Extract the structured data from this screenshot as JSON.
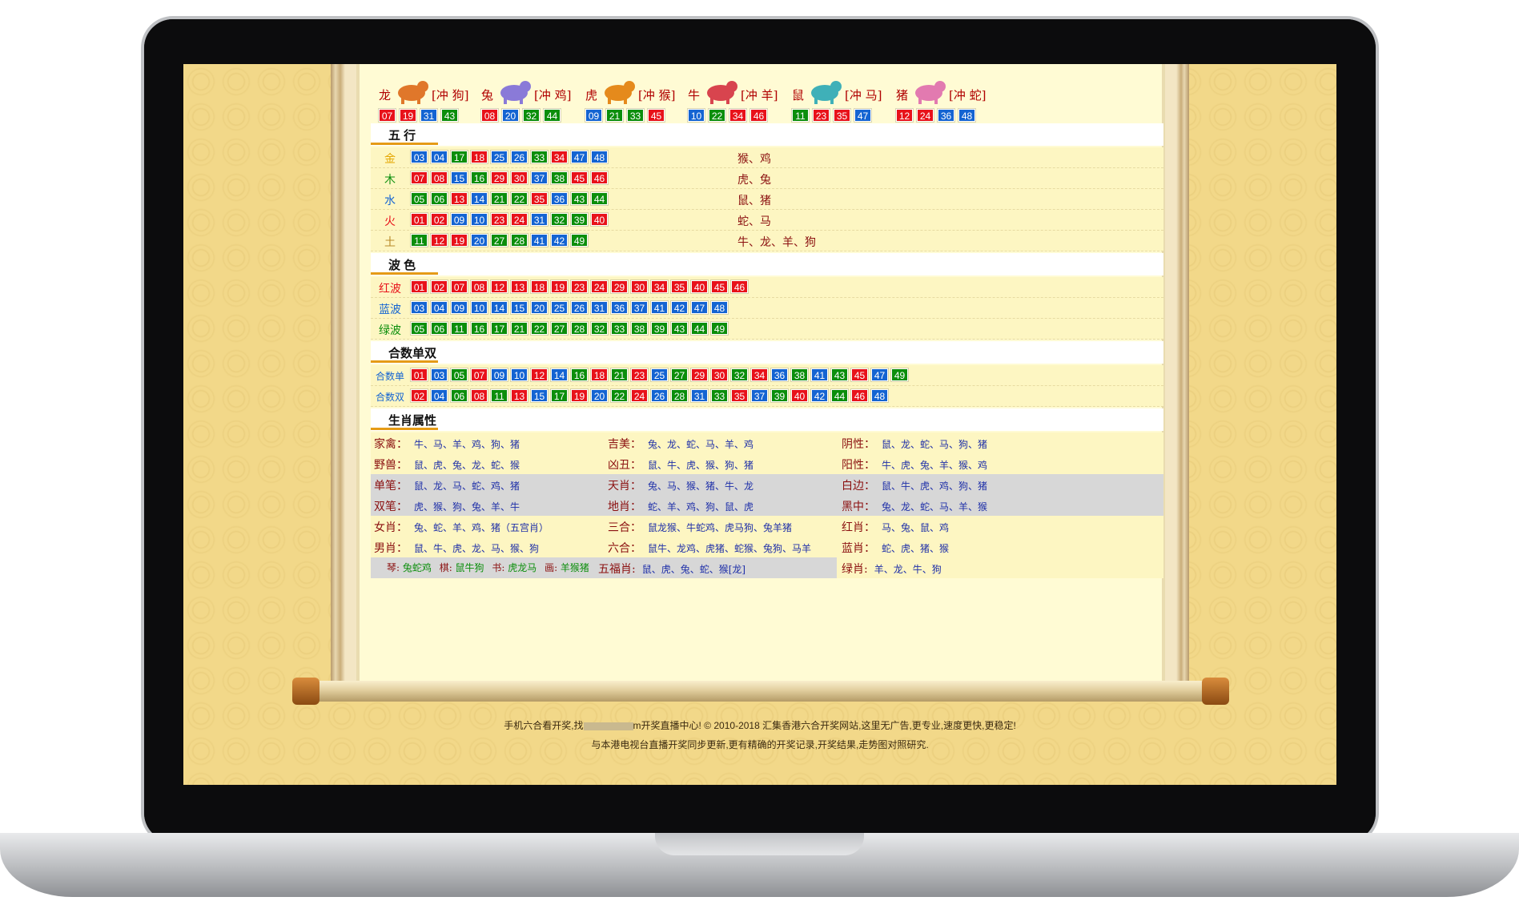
{
  "zodiac_row": [
    {
      "name": "龙",
      "clash": "[冲 狗]",
      "balls": [
        {
          "n": "07",
          "c": "r"
        },
        {
          "n": "19",
          "c": "r"
        },
        {
          "n": "31",
          "c": "b"
        },
        {
          "n": "43",
          "c": "g"
        }
      ]
    },
    {
      "name": "兔",
      "clash": "[冲 鸡]",
      "balls": [
        {
          "n": "08",
          "c": "r"
        },
        {
          "n": "20",
          "c": "b"
        },
        {
          "n": "32",
          "c": "g"
        },
        {
          "n": "44",
          "c": "g"
        }
      ]
    },
    {
      "name": "虎",
      "clash": "[冲 猴]",
      "balls": [
        {
          "n": "09",
          "c": "b"
        },
        {
          "n": "21",
          "c": "g"
        },
        {
          "n": "33",
          "c": "g"
        },
        {
          "n": "45",
          "c": "r"
        }
      ]
    },
    {
      "name": "牛",
      "clash": "[冲 羊]",
      "balls": [
        {
          "n": "10",
          "c": "b"
        },
        {
          "n": "22",
          "c": "g"
        },
        {
          "n": "34",
          "c": "r"
        },
        {
          "n": "46",
          "c": "r"
        }
      ]
    },
    {
      "name": "鼠",
      "clash": "[冲 马]",
      "balls": [
        {
          "n": "11",
          "c": "g"
        },
        {
          "n": "23",
          "c": "r"
        },
        {
          "n": "35",
          "c": "r"
        },
        {
          "n": "47",
          "c": "b"
        }
      ]
    },
    {
      "name": "猪",
      "clash": "[冲 蛇]",
      "balls": [
        {
          "n": "12",
          "c": "r"
        },
        {
          "n": "24",
          "c": "r"
        },
        {
          "n": "36",
          "c": "b"
        },
        {
          "n": "48",
          "c": "b"
        }
      ]
    }
  ],
  "sections": {
    "wuxing": "五 行",
    "bose": "波 色",
    "heshu": "合数单双",
    "shengxiao": "生肖属性"
  },
  "wuxing_rows": [
    {
      "label": "金",
      "color": "#e4a600",
      "balls": [
        {
          "n": "03",
          "c": "b"
        },
        {
          "n": "04",
          "c": "b"
        },
        {
          "n": "17",
          "c": "g"
        },
        {
          "n": "18",
          "c": "r"
        },
        {
          "n": "25",
          "c": "b"
        },
        {
          "n": "26",
          "c": "b"
        },
        {
          "n": "33",
          "c": "g"
        },
        {
          "n": "34",
          "c": "r"
        },
        {
          "n": "47",
          "c": "b"
        },
        {
          "n": "48",
          "c": "b"
        }
      ],
      "assoc": "猴、鸡"
    },
    {
      "label": "木",
      "color": "#0b8e0b",
      "balls": [
        {
          "n": "07",
          "c": "r"
        },
        {
          "n": "08",
          "c": "r"
        },
        {
          "n": "15",
          "c": "b"
        },
        {
          "n": "16",
          "c": "g"
        },
        {
          "n": "29",
          "c": "r"
        },
        {
          "n": "30",
          "c": "r"
        },
        {
          "n": "37",
          "c": "b"
        },
        {
          "n": "38",
          "c": "g"
        },
        {
          "n": "45",
          "c": "r"
        },
        {
          "n": "46",
          "c": "r"
        }
      ],
      "assoc": "虎、兔"
    },
    {
      "label": "水",
      "color": "#1464d2",
      "balls": [
        {
          "n": "05",
          "c": "g"
        },
        {
          "n": "06",
          "c": "g"
        },
        {
          "n": "13",
          "c": "r"
        },
        {
          "n": "14",
          "c": "b"
        },
        {
          "n": "21",
          "c": "g"
        },
        {
          "n": "22",
          "c": "g"
        },
        {
          "n": "35",
          "c": "r"
        },
        {
          "n": "36",
          "c": "b"
        },
        {
          "n": "43",
          "c": "g"
        },
        {
          "n": "44",
          "c": "g"
        }
      ],
      "assoc": "鼠、猪"
    },
    {
      "label": "火",
      "color": "#e8121a",
      "balls": [
        {
          "n": "01",
          "c": "r"
        },
        {
          "n": "02",
          "c": "r"
        },
        {
          "n": "09",
          "c": "b"
        },
        {
          "n": "10",
          "c": "b"
        },
        {
          "n": "23",
          "c": "r"
        },
        {
          "n": "24",
          "c": "r"
        },
        {
          "n": "31",
          "c": "b"
        },
        {
          "n": "32",
          "c": "g"
        },
        {
          "n": "39",
          "c": "g"
        },
        {
          "n": "40",
          "c": "r"
        }
      ],
      "assoc": "蛇、马"
    },
    {
      "label": "土",
      "color": "#b98a2a",
      "balls": [
        {
          "n": "11",
          "c": "g"
        },
        {
          "n": "12",
          "c": "r"
        },
        {
          "n": "19",
          "c": "r"
        },
        {
          "n": "20",
          "c": "b"
        },
        {
          "n": "27",
          "c": "g"
        },
        {
          "n": "28",
          "c": "g"
        },
        {
          "n": "41",
          "c": "b"
        },
        {
          "n": "42",
          "c": "b"
        },
        {
          "n": "49",
          "c": "g"
        }
      ],
      "assoc": "牛、龙、羊、狗"
    }
  ],
  "bose_rows": [
    {
      "label": "红波",
      "color": "#e8121a",
      "balls": [
        {
          "n": "01",
          "c": "r"
        },
        {
          "n": "02",
          "c": "r"
        },
        {
          "n": "07",
          "c": "r"
        },
        {
          "n": "08",
          "c": "r"
        },
        {
          "n": "12",
          "c": "r"
        },
        {
          "n": "13",
          "c": "r"
        },
        {
          "n": "18",
          "c": "r"
        },
        {
          "n": "19",
          "c": "r"
        },
        {
          "n": "23",
          "c": "r"
        },
        {
          "n": "24",
          "c": "r"
        },
        {
          "n": "29",
          "c": "r"
        },
        {
          "n": "30",
          "c": "r"
        },
        {
          "n": "34",
          "c": "r"
        },
        {
          "n": "35",
          "c": "r"
        },
        {
          "n": "40",
          "c": "r"
        },
        {
          "n": "45",
          "c": "r"
        },
        {
          "n": "46",
          "c": "r"
        }
      ]
    },
    {
      "label": "蓝波",
      "color": "#1464d2",
      "balls": [
        {
          "n": "03",
          "c": "b"
        },
        {
          "n": "04",
          "c": "b"
        },
        {
          "n": "09",
          "c": "b"
        },
        {
          "n": "10",
          "c": "b"
        },
        {
          "n": "14",
          "c": "b"
        },
        {
          "n": "15",
          "c": "b"
        },
        {
          "n": "20",
          "c": "b"
        },
        {
          "n": "25",
          "c": "b"
        },
        {
          "n": "26",
          "c": "b"
        },
        {
          "n": "31",
          "c": "b"
        },
        {
          "n": "36",
          "c": "b"
        },
        {
          "n": "37",
          "c": "b"
        },
        {
          "n": "41",
          "c": "b"
        },
        {
          "n": "42",
          "c": "b"
        },
        {
          "n": "47",
          "c": "b"
        },
        {
          "n": "48",
          "c": "b"
        }
      ]
    },
    {
      "label": "绿波",
      "color": "#0b8e0b",
      "balls": [
        {
          "n": "05",
          "c": "g"
        },
        {
          "n": "06",
          "c": "g"
        },
        {
          "n": "11",
          "c": "g"
        },
        {
          "n": "16",
          "c": "g"
        },
        {
          "n": "17",
          "c": "g"
        },
        {
          "n": "21",
          "c": "g"
        },
        {
          "n": "22",
          "c": "g"
        },
        {
          "n": "27",
          "c": "g"
        },
        {
          "n": "28",
          "c": "g"
        },
        {
          "n": "32",
          "c": "g"
        },
        {
          "n": "33",
          "c": "g"
        },
        {
          "n": "38",
          "c": "g"
        },
        {
          "n": "39",
          "c": "g"
        },
        {
          "n": "43",
          "c": "g"
        },
        {
          "n": "44",
          "c": "g"
        },
        {
          "n": "49",
          "c": "g"
        }
      ]
    }
  ],
  "heshu_rows": [
    {
      "label": "合数单",
      "color": "#1464d2",
      "balls": [
        {
          "n": "01",
          "c": "r"
        },
        {
          "n": "03",
          "c": "b"
        },
        {
          "n": "05",
          "c": "g"
        },
        {
          "n": "07",
          "c": "r"
        },
        {
          "n": "09",
          "c": "b"
        },
        {
          "n": "10",
          "c": "b"
        },
        {
          "n": "12",
          "c": "r"
        },
        {
          "n": "14",
          "c": "b"
        },
        {
          "n": "16",
          "c": "g"
        },
        {
          "n": "18",
          "c": "r"
        },
        {
          "n": "21",
          "c": "g"
        },
        {
          "n": "23",
          "c": "r"
        },
        {
          "n": "25",
          "c": "b"
        },
        {
          "n": "27",
          "c": "g"
        },
        {
          "n": "29",
          "c": "r"
        },
        {
          "n": "30",
          "c": "r"
        },
        {
          "n": "32",
          "c": "g"
        },
        {
          "n": "34",
          "c": "r"
        },
        {
          "n": "36",
          "c": "b"
        },
        {
          "n": "38",
          "c": "g"
        },
        {
          "n": "41",
          "c": "b"
        },
        {
          "n": "43",
          "c": "g"
        },
        {
          "n": "45",
          "c": "r"
        },
        {
          "n": "47",
          "c": "b"
        },
        {
          "n": "49",
          "c": "g"
        }
      ]
    },
    {
      "label": "合数双",
      "color": "#1464d2",
      "balls": [
        {
          "n": "02",
          "c": "r"
        },
        {
          "n": "04",
          "c": "b"
        },
        {
          "n": "06",
          "c": "g"
        },
        {
          "n": "08",
          "c": "r"
        },
        {
          "n": "11",
          "c": "g"
        },
        {
          "n": "13",
          "c": "r"
        },
        {
          "n": "15",
          "c": "b"
        },
        {
          "n": "17",
          "c": "g"
        },
        {
          "n": "19",
          "c": "r"
        },
        {
          "n": "20",
          "c": "b"
        },
        {
          "n": "22",
          "c": "g"
        },
        {
          "n": "24",
          "c": "r"
        },
        {
          "n": "26",
          "c": "b"
        },
        {
          "n": "28",
          "c": "g"
        },
        {
          "n": "31",
          "c": "b"
        },
        {
          "n": "33",
          "c": "g"
        },
        {
          "n": "35",
          "c": "r"
        },
        {
          "n": "37",
          "c": "b"
        },
        {
          "n": "39",
          "c": "g"
        },
        {
          "n": "40",
          "c": "r"
        },
        {
          "n": "42",
          "c": "b"
        },
        {
          "n": "44",
          "c": "g"
        },
        {
          "n": "46",
          "c": "r"
        },
        {
          "n": "48",
          "c": "b"
        }
      ]
    }
  ],
  "attributes": [
    {
      "shade": "",
      "cells": [
        {
          "k": "家禽：",
          "v": "牛、马、羊、鸡、狗、猪"
        },
        {
          "k": "吉美：",
          "v": "兔、龙、蛇、马、羊、鸡"
        },
        {
          "k": "阴性：",
          "v": "鼠、龙、蛇、马、狗、猪"
        }
      ]
    },
    {
      "shade": "",
      "cells": [
        {
          "k": "野兽：",
          "v": "鼠、虎、兔、龙、蛇、猴"
        },
        {
          "k": "凶丑：",
          "v": "鼠、牛、虎、猴、狗、猪"
        },
        {
          "k": "阳性：",
          "v": "牛、虎、兔、羊、猴、鸡"
        }
      ]
    },
    {
      "shade": "grey",
      "cells": [
        {
          "k": "单笔：",
          "v": "鼠、龙、马、蛇、鸡、猪"
        },
        {
          "k": "天肖：",
          "v": "兔、马、猴、猪、牛、龙"
        },
        {
          "k": "白边：",
          "v": "鼠、牛、虎、鸡、狗、猪"
        }
      ]
    },
    {
      "shade": "grey",
      "cells": [
        {
          "k": "双笔：",
          "v": "虎、猴、狗、兔、羊、牛"
        },
        {
          "k": "地肖：",
          "v": "蛇、羊、鸡、狗、鼠、虎"
        },
        {
          "k": "黑中：",
          "v": "兔、龙、蛇、马、羊、猴"
        }
      ]
    },
    {
      "shade": "",
      "cells": [
        {
          "k": "女肖：",
          "v": "兔、蛇、羊、鸡、猪（五宫肖）"
        },
        {
          "k": "三合：",
          "v": "鼠龙猴、牛蛇鸡、虎马狗、兔羊猪"
        },
        {
          "k": "红肖：",
          "v": "马、兔、鼠、鸡"
        }
      ]
    },
    {
      "shade": "",
      "cells": [
        {
          "k": "男肖：",
          "v": "鼠、牛、虎、龙、马、猴、狗"
        },
        {
          "k": "六合：",
          "v": "鼠牛、龙鸡、虎猪、蛇猴、兔狗、马羊"
        },
        {
          "k": "蓝肖：",
          "v": "蛇、虎、猪、猴"
        }
      ]
    }
  ],
  "last_row": {
    "qin_label": "琴:",
    "qin": "兔蛇鸡",
    "qi_label": "棋:",
    "qi": "鼠牛狗",
    "shu_label": "书:",
    "shu": "虎龙马",
    "hua_label": "画:",
    "hua": "羊猴猪",
    "wufu_label": "五福肖:",
    "wufu": "鼠、虎、兔、蛇、猴[龙]",
    "lv_label": "绿肖:",
    "lv": "羊、龙、牛、狗"
  },
  "footer": {
    "line1_a": "手机六合看开奖,找",
    "line1_b": "m开奖直播中心! © 2010-2018 汇集香港六合开奖网站,这里无广告,更专业,速度更快,更稳定!",
    "line2": "与本港电视台直播开奖同步更新,更有精确的开奖记录,开奖结果,走势图对照研究."
  }
}
